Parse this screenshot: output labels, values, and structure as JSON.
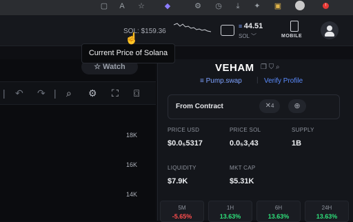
{
  "header": {
    "sol_price": "SOL: $159.36",
    "wallet_amount": "44.51",
    "wallet_currency": "SOL",
    "mobile_label": "MOBILE"
  },
  "tooltip": {
    "text": "Current Price of Solana"
  },
  "chart": {
    "watch_label": "Watch",
    "y_labels": [
      "18K",
      "16K",
      "14K"
    ]
  },
  "token": {
    "name": "VEHAM",
    "pump_label": "Pump.swap",
    "verify_label": "Verify Profile",
    "contract_label": "From Contract",
    "x_count": "4",
    "stats": [
      {
        "label": "PRICE USD",
        "value": "$0.0₅5317"
      },
      {
        "label": "PRICE SOL",
        "value": "0.0₅3,43"
      },
      {
        "label": "SUPPLY",
        "value": "1B"
      },
      {
        "label": "LIQUIDITY",
        "value": "$7.9K"
      },
      {
        "label": "MKT CAP",
        "value": "$5.31K"
      }
    ],
    "timeframes": [
      {
        "label": "5M",
        "value": "-5.65%",
        "color": "#ff4d4d"
      },
      {
        "label": "1H",
        "value": "13.63%",
        "color": "#2ee07a"
      },
      {
        "label": "6H",
        "value": "13.63%",
        "color": "#2ee07a"
      },
      {
        "label": "24H",
        "value": "13.63%",
        "color": "#2ee07a"
      }
    ]
  },
  "colors": {
    "positive": "#2ee07a",
    "negative": "#ff4d4d",
    "accent": "#5b8cff"
  }
}
